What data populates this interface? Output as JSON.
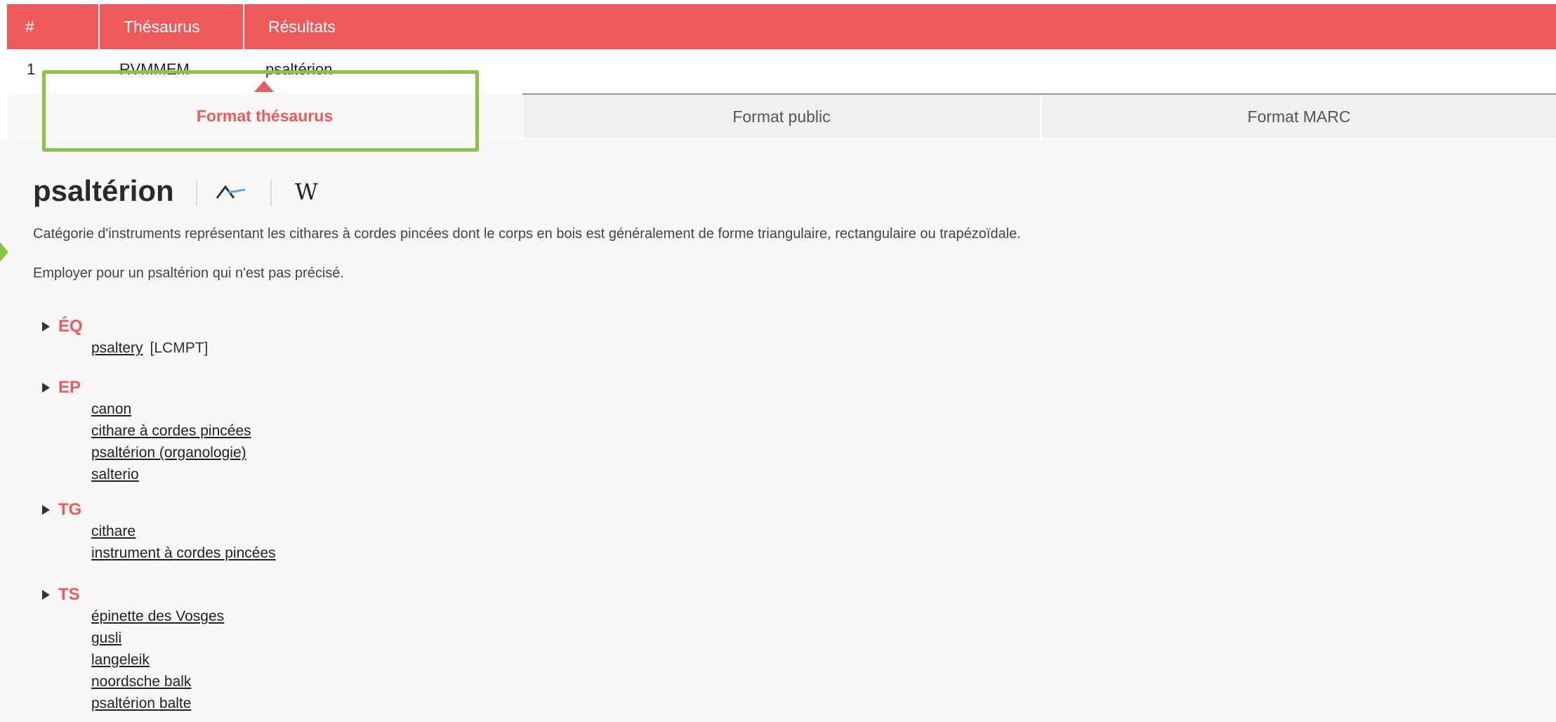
{
  "results_table": {
    "headers": {
      "num": "#",
      "thesaurus": "Thésaurus",
      "results": "Résultats"
    },
    "row": {
      "num": "1",
      "thesaurus": "RVMMEM",
      "result": "psaltérion"
    }
  },
  "format_tabs": {
    "thesaurus": "Format thésaurus",
    "public": "Format public",
    "marc": "Format MARC",
    "active": "thesaurus"
  },
  "term": {
    "title": "psaltérion",
    "definition": "Catégorie d'instruments représentant les cithares à cordes pincées dont le corps en bois est généralement de forme triangulaire, rectangulaire ou trapézoïdale.",
    "usage_note": "Employer pour un psaltérion qui n'est pas précisé."
  },
  "sections": {
    "eq": {
      "label": "ÉQ",
      "items": [
        {
          "text": "psaltery",
          "source": "[LCMPT]"
        }
      ]
    },
    "ep": {
      "label": "EP",
      "items": [
        "canon",
        "cithare à cordes pincées",
        "psaltérion (organologie)",
        "salterio"
      ]
    },
    "tg": {
      "label": "TG",
      "items": [
        "cithare",
        "instrument à cordes pincées"
      ]
    },
    "ts": {
      "label": "TS",
      "items": [
        "épinette des Vosges",
        "gusli",
        "langeleik",
        "noordsche balk",
        "psaltérion balte"
      ]
    }
  },
  "icons": {
    "graph": "graph-view-icon",
    "wiki": "wikipedia-icon",
    "expand": "triangle-right-icon"
  },
  "colors": {
    "accent": "#ee5a5c",
    "highlight": "#8bc34a"
  }
}
